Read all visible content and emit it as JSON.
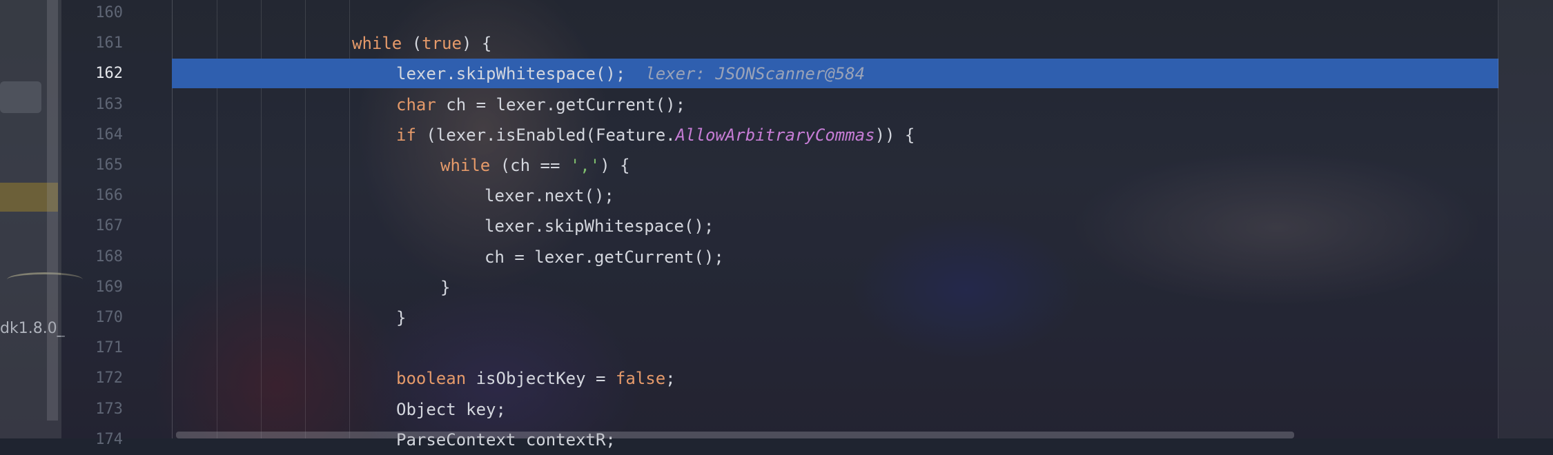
{
  "left_panel": {
    "sdk_label": "dk1.8.0_"
  },
  "editor": {
    "current_line": "162",
    "lines": [
      {
        "n": "160",
        "indent": 0,
        "parts": []
      },
      {
        "n": "161",
        "indent": 0,
        "parts": [
          {
            "t": "while",
            "c": "kw"
          },
          {
            "t": " ("
          },
          {
            "t": "true",
            "c": "kw"
          },
          {
            "t": ") {"
          }
        ]
      },
      {
        "n": "162",
        "indent": 1,
        "parts": [
          {
            "t": "lexer.skipWhitespace();"
          },
          {
            "t": "  lexer: JSONScanner@584",
            "c": "hint"
          }
        ]
      },
      {
        "n": "163",
        "indent": 1,
        "parts": [
          {
            "t": "char",
            "c": "kw"
          },
          {
            "t": " ch = lexer.getCurrent();"
          }
        ]
      },
      {
        "n": "164",
        "indent": 1,
        "parts": [
          {
            "t": "if",
            "c": "kw"
          },
          {
            "t": " (lexer.isEnabled(Feature."
          },
          {
            "t": "AllowArbitraryCommas",
            "c": "field"
          },
          {
            "t": ")) {"
          }
        ]
      },
      {
        "n": "165",
        "indent": 2,
        "parts": [
          {
            "t": "while",
            "c": "kw"
          },
          {
            "t": " (ch == "
          },
          {
            "t": "','",
            "c": "str"
          },
          {
            "t": ") {"
          }
        ]
      },
      {
        "n": "166",
        "indent": 3,
        "parts": [
          {
            "t": "lexer.next();"
          }
        ]
      },
      {
        "n": "167",
        "indent": 3,
        "parts": [
          {
            "t": "lexer.skipWhitespace();"
          }
        ]
      },
      {
        "n": "168",
        "indent": 3,
        "parts": [
          {
            "t": "ch = lexer.getCurrent();"
          }
        ]
      },
      {
        "n": "169",
        "indent": 2,
        "parts": [
          {
            "t": "}"
          }
        ]
      },
      {
        "n": "170",
        "indent": 1,
        "parts": [
          {
            "t": "}"
          }
        ]
      },
      {
        "n": "171",
        "indent": 0,
        "parts": []
      },
      {
        "n": "172",
        "indent": 1,
        "parts": [
          {
            "t": "boolean",
            "c": "kw"
          },
          {
            "t": " isObjectKey = "
          },
          {
            "t": "false",
            "c": "kw"
          },
          {
            "t": ";"
          }
        ]
      },
      {
        "n": "173",
        "indent": 1,
        "parts": [
          {
            "t": "Object key;"
          }
        ]
      },
      {
        "n": "174",
        "indent": 1,
        "parts": [
          {
            "t": "ParseContext contextR;"
          }
        ]
      }
    ]
  }
}
